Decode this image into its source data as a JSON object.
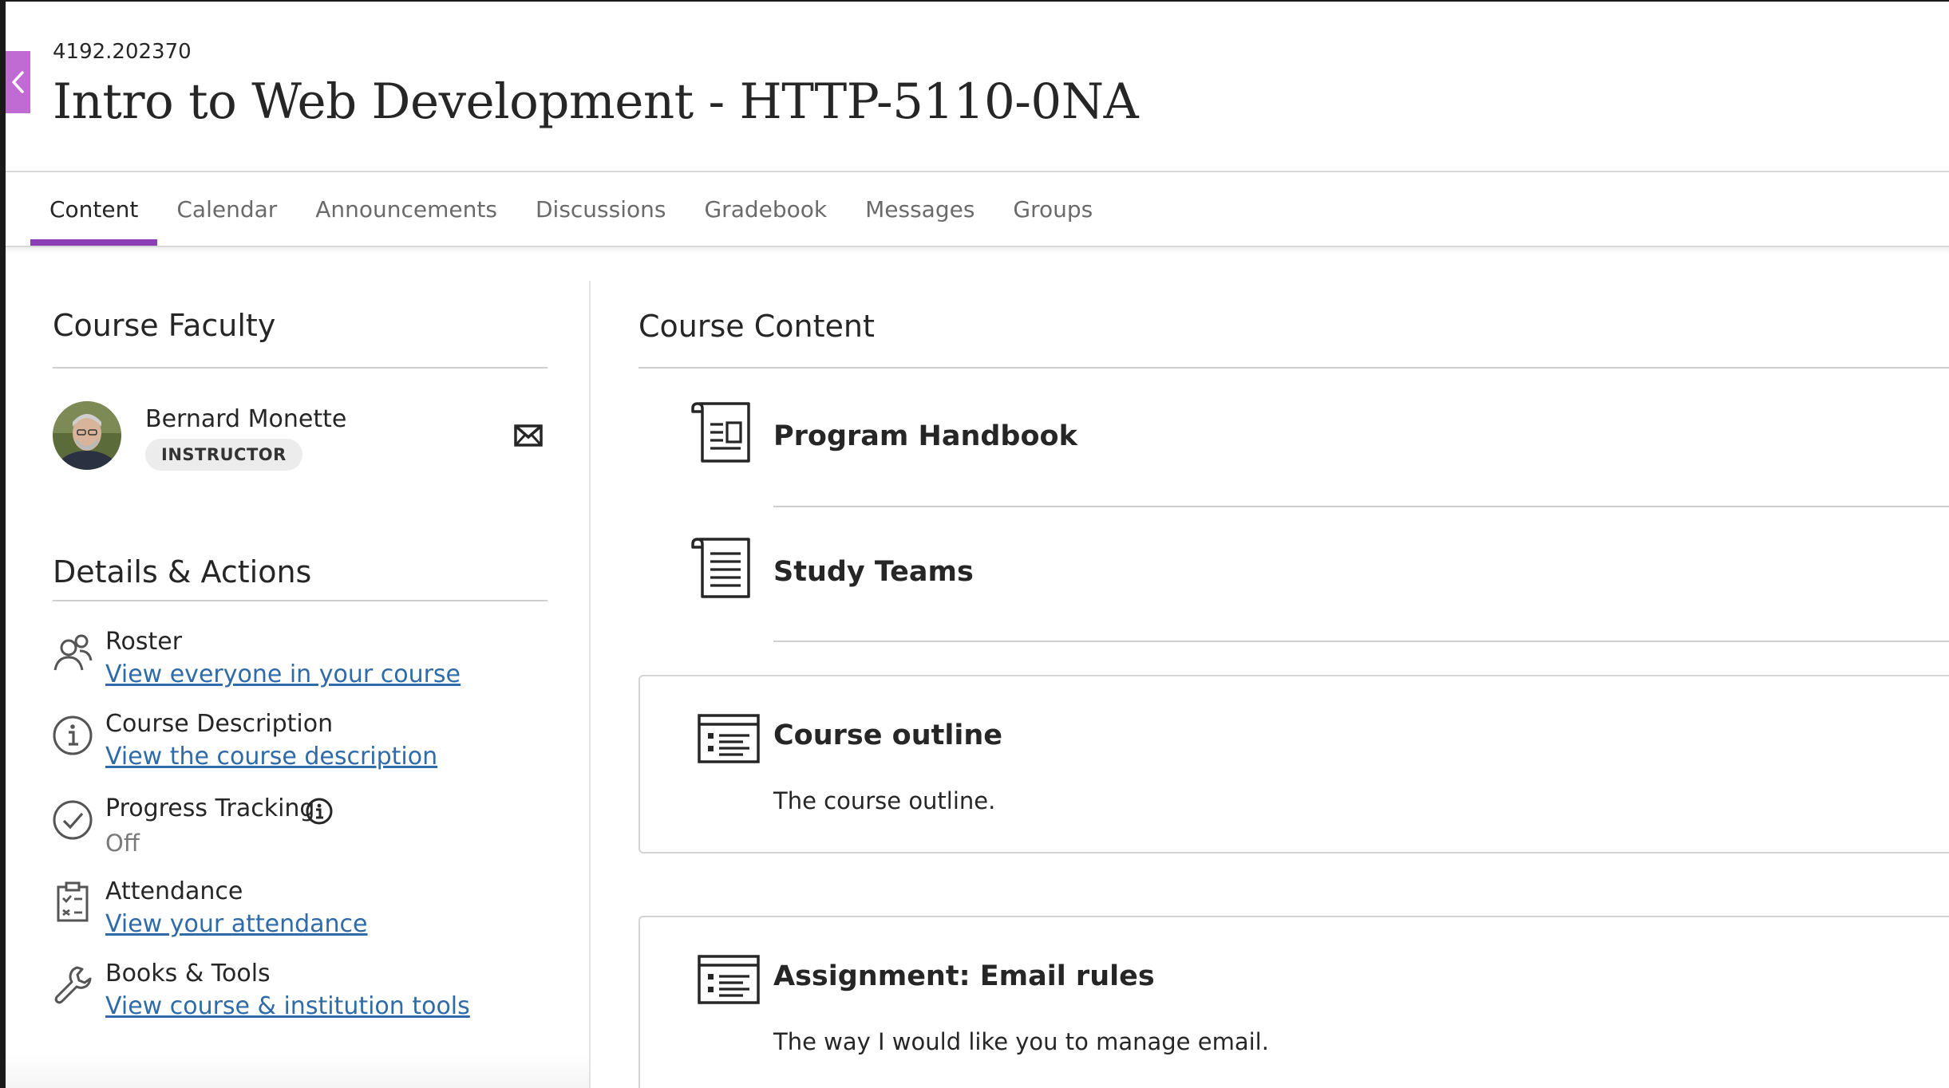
{
  "header": {
    "course_id": "4192.202370",
    "course_title": "Intro to Web Development - HTTP-5110-0NA"
  },
  "tabs": [
    {
      "label": "Content",
      "active": true
    },
    {
      "label": "Calendar",
      "active": false
    },
    {
      "label": "Announcements",
      "active": false
    },
    {
      "label": "Discussions",
      "active": false
    },
    {
      "label": "Gradebook",
      "active": false
    },
    {
      "label": "Messages",
      "active": false
    },
    {
      "label": "Groups",
      "active": false
    }
  ],
  "faculty": {
    "heading": "Course Faculty",
    "name": "Bernard Monette",
    "role": "INSTRUCTOR"
  },
  "details": {
    "heading": "Details & Actions",
    "items": [
      {
        "label": "Roster",
        "link": "View everyone in your course",
        "icon": "people-icon"
      },
      {
        "label": "Course Description",
        "link": "View the course description",
        "icon": "info-icon"
      },
      {
        "label": "Progress Tracking",
        "status": "Off",
        "icon": "check-circle-icon"
      },
      {
        "label": "Attendance",
        "link": "View your attendance",
        "icon": "clipboard-icon"
      },
      {
        "label": "Books & Tools",
        "link": "View course & institution tools",
        "icon": "wrench-icon"
      }
    ]
  },
  "content": {
    "heading": "Course Content",
    "items": [
      {
        "title": "Program Handbook",
        "icon": "document-icon"
      },
      {
        "title": "Study Teams",
        "icon": "document-icon"
      },
      {
        "title": "Course outline",
        "description": "The course outline.",
        "icon": "list-document-icon"
      },
      {
        "title": "Assignment: Email rules",
        "description": "The way I would like you to manage email.",
        "icon": "list-document-icon"
      }
    ]
  },
  "colors": {
    "accent": "#8b3fb4",
    "close_tab": "#c06bd3",
    "link": "#2f6ba8"
  }
}
